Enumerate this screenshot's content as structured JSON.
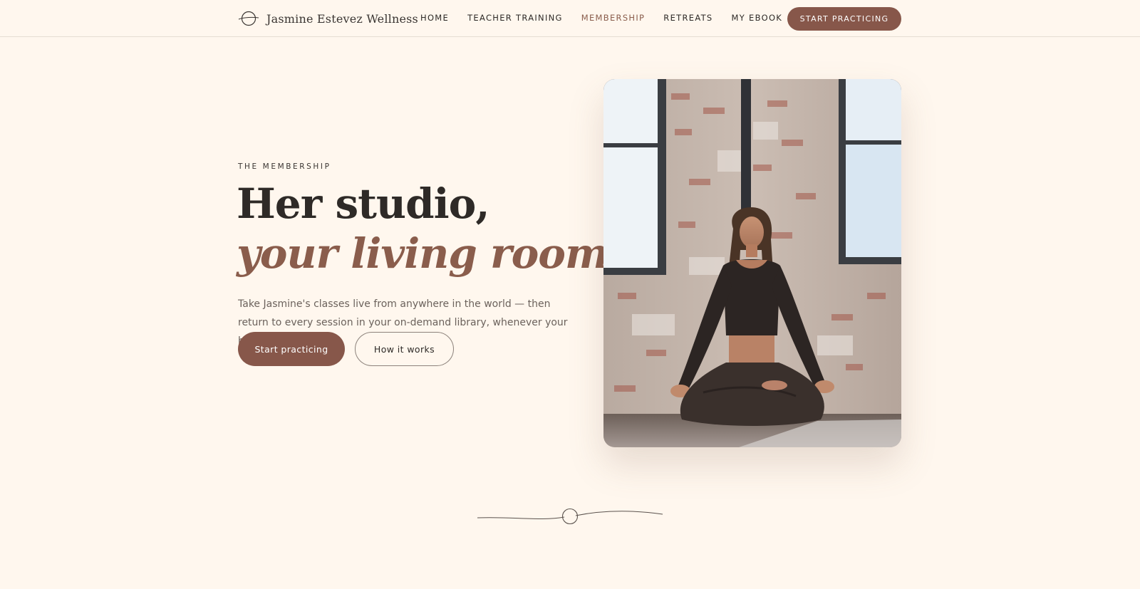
{
  "header": {
    "brand_name": "Jasmine Estevez Wellness",
    "brand_icon": "circle-orbit-logo",
    "nav": [
      {
        "label": "HOME",
        "active": false
      },
      {
        "label": "TEACHER TRAINING",
        "active": false
      },
      {
        "label": "MEMBERSHIP",
        "active": true
      },
      {
        "label": "RETREATS",
        "active": false
      },
      {
        "label": "MY EBOOK",
        "active": false
      }
    ],
    "cta_label": "START PRACTICING"
  },
  "hero": {
    "eyebrow": "THE MEMBERSHIP",
    "headline_line1": "Her studio,",
    "headline_line2": "your living room.",
    "lede": "Take Jasmine's classes live from anywhere in the world — then return to every session in your on-demand library, whenever your body asks for it.",
    "primary_button": "Start practicing",
    "secondary_button": "How it works",
    "photo_subject": "woman meditating cross-legged in a brick-walled studio"
  },
  "colors": {
    "background": "#fff7ee",
    "accent": "#87574a",
    "text": "#2e2a27",
    "muted_text": "#6b625c"
  }
}
